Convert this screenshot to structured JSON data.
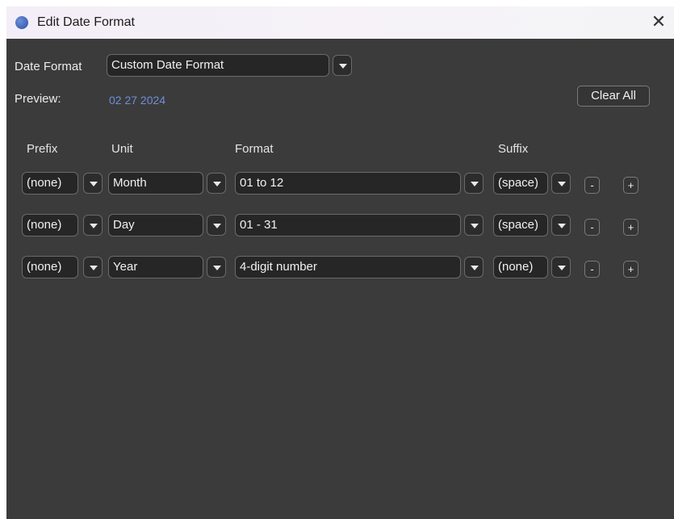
{
  "window": {
    "title": "Edit Date Format",
    "close_glyph": "✕",
    "app_icon": "blue-circle-icon"
  },
  "date_format": {
    "label": "Date Format",
    "value": "Custom Date Format"
  },
  "preview": {
    "label": "Preview:",
    "value": "02 27 2024"
  },
  "clear_all_label": "Clear All",
  "columns": {
    "prefix": "Prefix",
    "unit": "Unit",
    "format": "Format",
    "suffix": "Suffix"
  },
  "rows": [
    {
      "prefix": "(none)",
      "unit": "Month",
      "format": "01 to 12",
      "suffix": "(space)",
      "remove": "-",
      "add": "+"
    },
    {
      "prefix": "(none)",
      "unit": "Day",
      "format": "01 - 31",
      "suffix": "(space)",
      "remove": "-",
      "add": "+"
    },
    {
      "prefix": "(none)",
      "unit": "Year",
      "format": "4-digit number",
      "suffix": "(none)",
      "remove": "-",
      "add": "+"
    }
  ],
  "colors": {
    "panel": "#3b3b3b",
    "field": "#262626",
    "preview_accent": "#6f8fd8"
  }
}
